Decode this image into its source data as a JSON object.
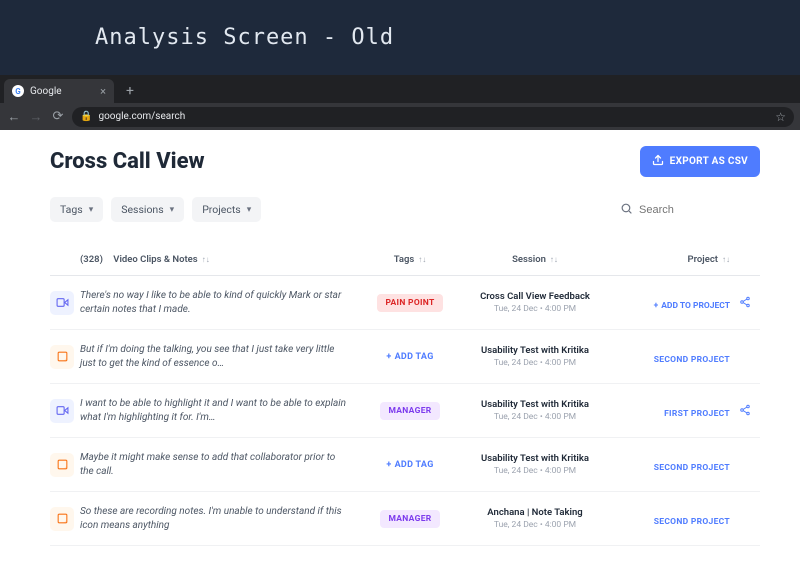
{
  "presentation": {
    "title": "Analysis Screen - Old"
  },
  "browser": {
    "tab_label": "Google",
    "url": "google.com/search"
  },
  "page": {
    "title": "Cross Call View",
    "export_label": "EXPORT AS CSV"
  },
  "filters": {
    "tags": "Tags",
    "sessions": "Sessions",
    "projects": "Projects"
  },
  "search": {
    "placeholder": "Search"
  },
  "columns": {
    "clips_count": "(328)",
    "clips_label": "Video Clips & Notes",
    "tags": "Tags",
    "session": "Session",
    "project": "Project"
  },
  "labels": {
    "add_tag": "ADD TAG",
    "add_to_project": "ADD TO PROJECT"
  },
  "rows": [
    {
      "type": "video",
      "text": "There's no way I like to be able to kind of quickly Mark or star certain notes that I made.",
      "tag": "PAIN POINT",
      "tag_style": "pain",
      "session_name": "Cross Call View Feedback",
      "session_date": "Tue, 24 Dec • 4:00 PM",
      "project": null,
      "shareable": true
    },
    {
      "type": "note",
      "text": "But if I'm doing the talking, you see that I just take very little just to get the kind of essence o…",
      "tag": null,
      "tag_style": null,
      "session_name": "Usability Test with Kritika",
      "session_date": "Tue, 24 Dec • 4:00 PM",
      "project": "SECOND PROJECT",
      "shareable": false
    },
    {
      "type": "video",
      "text": "I want to be able to highlight it and I want to be able to explain what I'm highlighting it for. I'm…",
      "tag": "MANAGER",
      "tag_style": "manager",
      "session_name": "Usability Test with Kritika",
      "session_date": "Tue, 24 Dec • 4:00 PM",
      "project": "FIRST PROJECT",
      "shareable": true
    },
    {
      "type": "note",
      "text": "Maybe it might make sense to add that collaborator prior to the call.",
      "tag": null,
      "tag_style": null,
      "session_name": "Usability Test with Kritika",
      "session_date": "Tue, 24 Dec • 4:00 PM",
      "project": "SECOND PROJECT",
      "shareable": false
    },
    {
      "type": "note",
      "text": "So these are recording notes. I'm unable to understand if this icon means anything",
      "tag": "MANAGER",
      "tag_style": "manager",
      "session_name": "Anchana | Note Taking",
      "session_date": "Tue, 24 Dec • 4:00 PM",
      "project": "SECOND PROJECT",
      "shareable": false
    }
  ]
}
